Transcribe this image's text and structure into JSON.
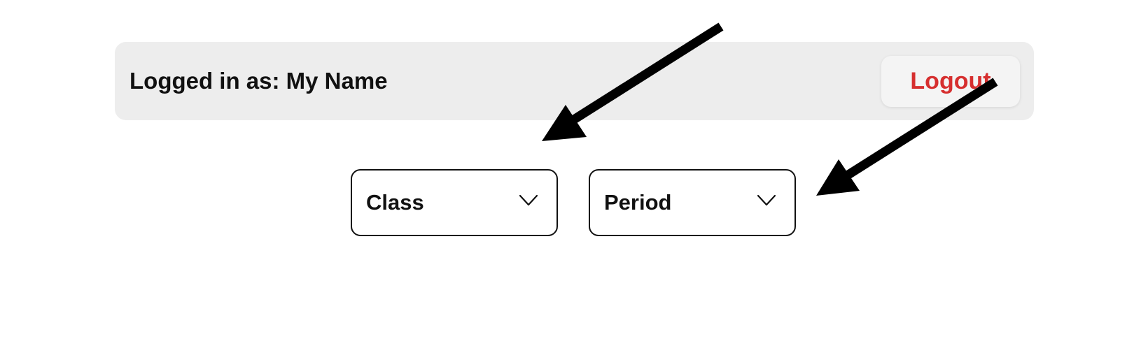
{
  "header": {
    "user_label": "Logged in as: My Name",
    "logout_label": "Logout"
  },
  "filters": {
    "class": {
      "selected": "Class"
    },
    "period": {
      "selected": "Period"
    }
  },
  "icons": {
    "dropdown_chevron": "chevron-down-icon",
    "annotation": "arrow-icon"
  },
  "colors": {
    "header_background": "#ededed",
    "logout_text": "#d62f2f",
    "annotation_arrows": "#000000"
  }
}
